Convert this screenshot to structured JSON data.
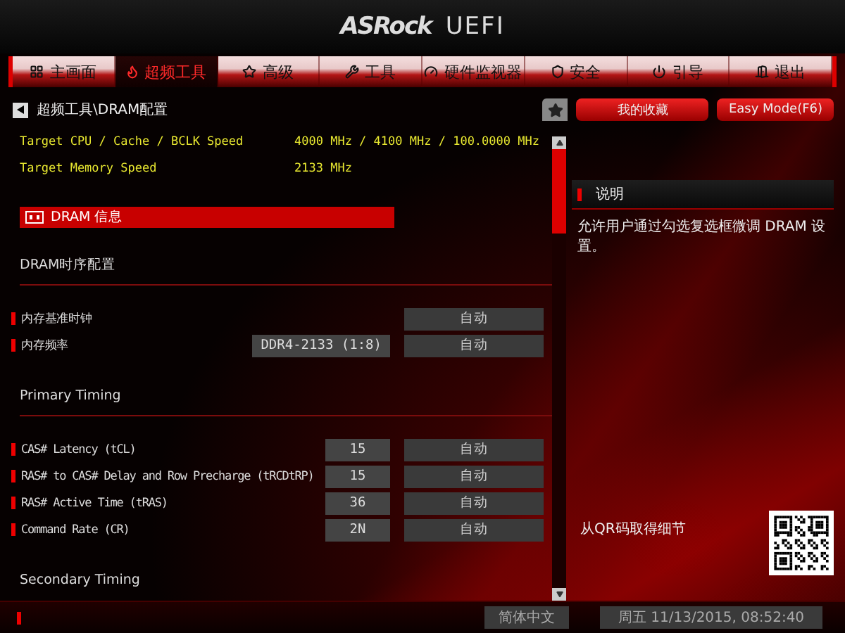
{
  "header": {
    "logo": "ASRock",
    "product": "UEFI"
  },
  "tabs": [
    {
      "label": "主画面",
      "selected": false
    },
    {
      "label": "超频工具",
      "selected": true
    },
    {
      "label": "高级",
      "selected": false
    },
    {
      "label": "工具",
      "selected": false
    },
    {
      "label": "硬件监视器",
      "selected": false
    },
    {
      "label": "安全",
      "selected": false
    },
    {
      "label": "引导",
      "selected": false
    },
    {
      "label": "退出",
      "selected": false
    }
  ],
  "breadcrumb": "超频工具\\DRAM配置",
  "favorites_button": "我的收藏",
  "easy_mode_button": "Easy Mode(F6)",
  "rows": [
    {
      "kind": "info",
      "label": "Target CPU / Cache / BCLK Speed",
      "value": "4000 MHz / 4100 MHz / 100.0000 MHz"
    },
    {
      "kind": "info",
      "label": "Target Memory Speed",
      "value": "2133 MHz"
    },
    {
      "kind": "section",
      "label": "DRAM 信息",
      "selected": true
    },
    {
      "kind": "heading",
      "label": "DRAM时序配置",
      "underline": true
    },
    {
      "kind": "setting",
      "label": "内存基准时钟",
      "option": "自动"
    },
    {
      "kind": "setting",
      "label": "内存频率",
      "value": "DDR4-2133 (1:8)",
      "option": "自动"
    },
    {
      "kind": "heading",
      "label": "Primary Timing",
      "underline": true
    },
    {
      "kind": "setting",
      "label": "CAS# Latency (tCL)",
      "value": "15",
      "option": "自动"
    },
    {
      "kind": "setting",
      "label": "RAS# to CAS# Delay and Row Precharge (tRCDtRP)",
      "value": "15",
      "option": "自动"
    },
    {
      "kind": "setting",
      "label": "RAS# Active Time (tRAS)",
      "value": "36",
      "option": "自动"
    },
    {
      "kind": "setting",
      "label": "Command Rate (CR)",
      "value": "2N",
      "option": "自动"
    },
    {
      "kind": "heading",
      "label": "Secondary Timing",
      "underline": false
    }
  ],
  "help": {
    "title": "说明",
    "text": "允许用户通过勾选复选框微调 DRAM 设置。",
    "qr_label": "从QR码取得细节"
  },
  "status_bar": {
    "language": "简体中文",
    "datetime": "周五 11/13/2015, 08:52:40"
  }
}
